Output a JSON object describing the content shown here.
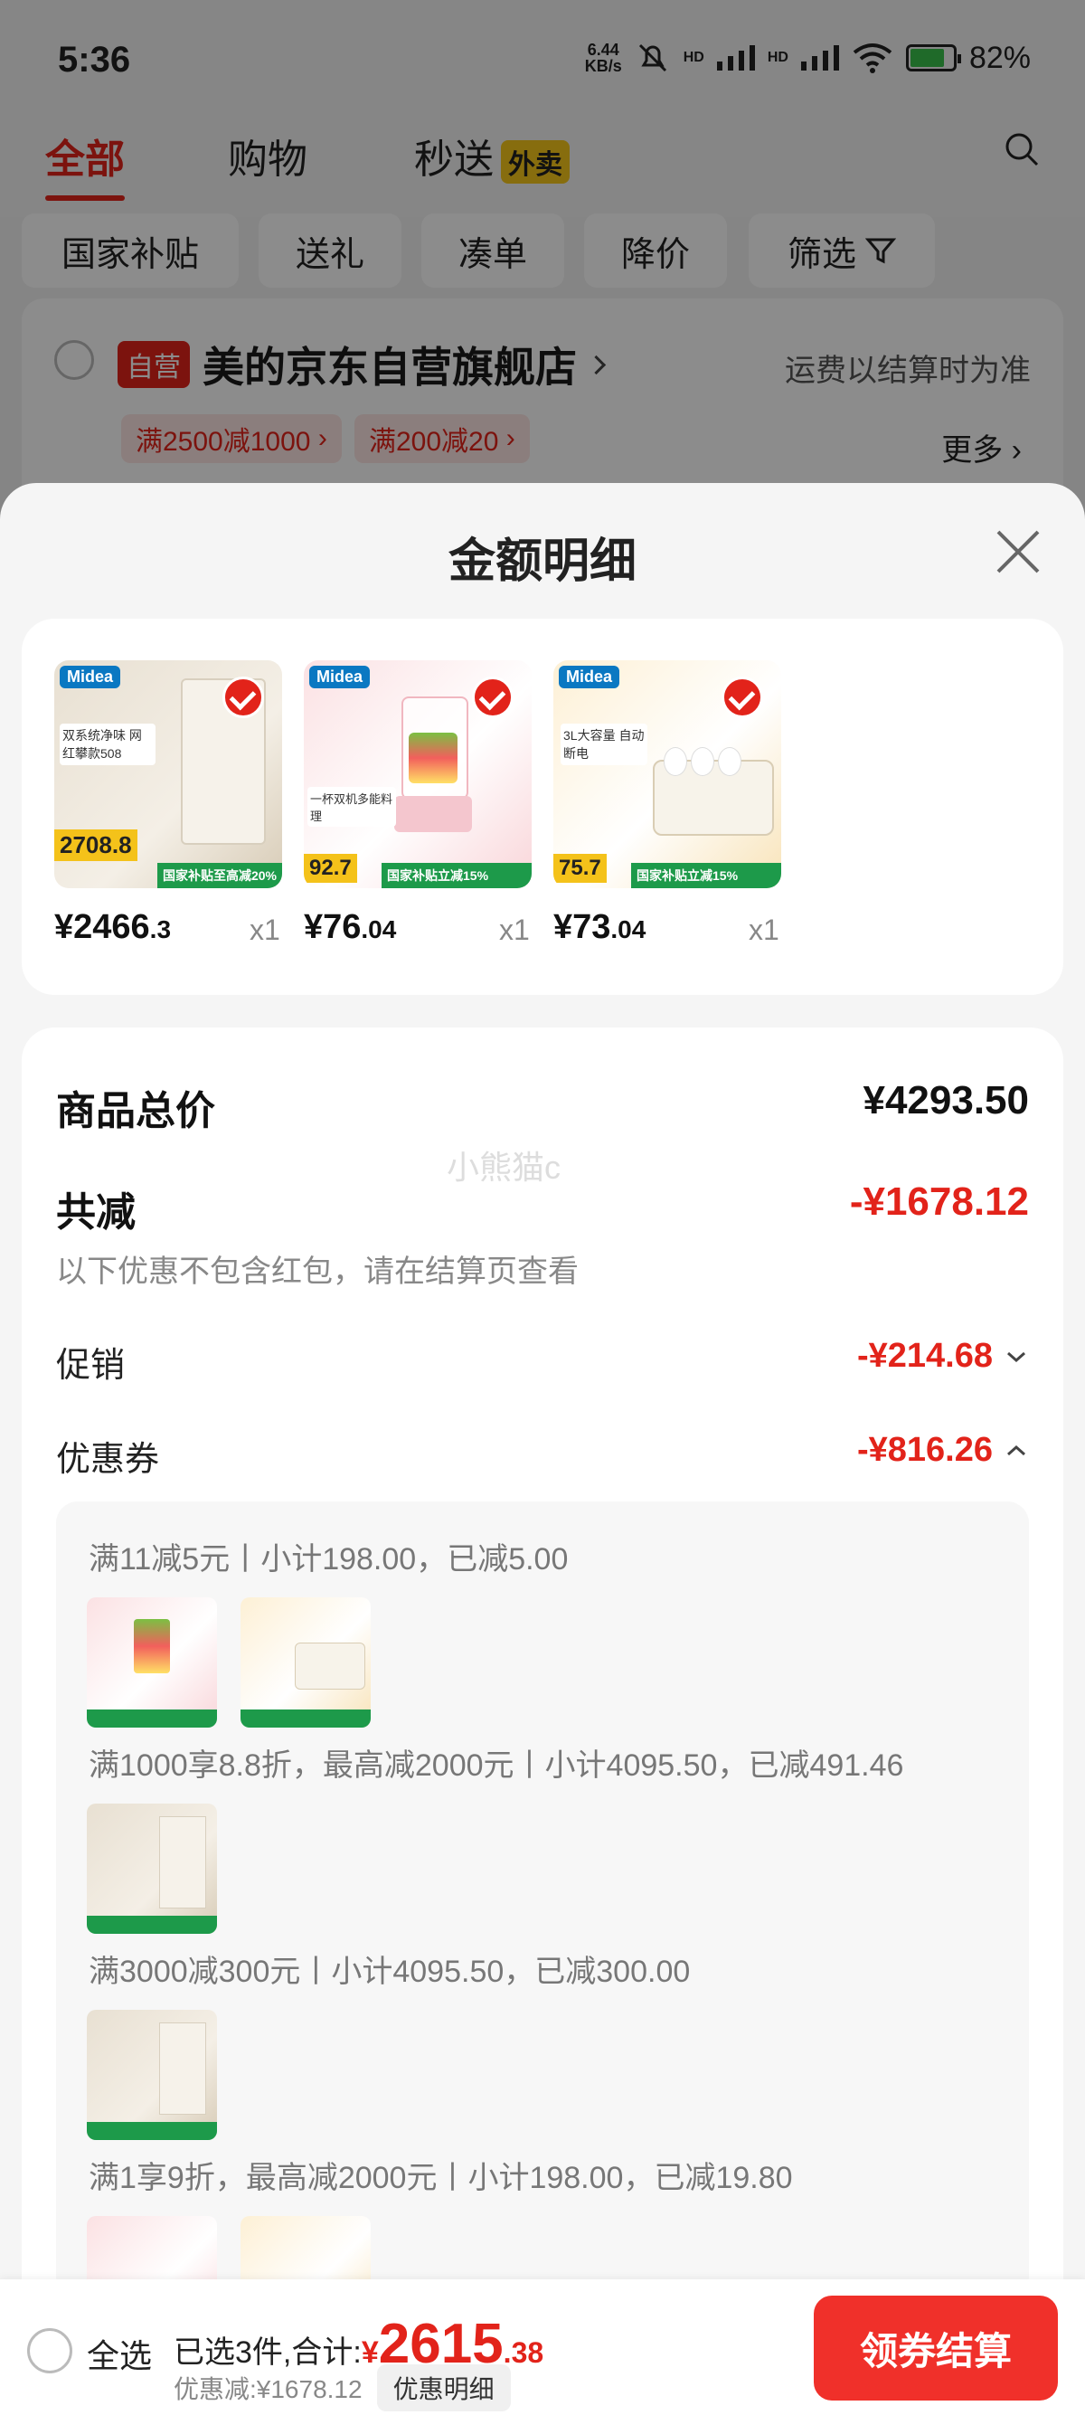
{
  "status_bar": {
    "time": "5:36",
    "net_speed_value": "6.44",
    "net_speed_unit": "KB/s",
    "battery_percent": "82%",
    "hd1": "HD",
    "hd2": "HD",
    "wifi_label": "6"
  },
  "top_tabs": [
    {
      "label": "全部",
      "active": true
    },
    {
      "label": "购物",
      "active": false
    },
    {
      "label": "秒送",
      "badge": "外卖",
      "active": false
    }
  ],
  "filters": [
    "国家补贴",
    "送礼",
    "凑单",
    "降价",
    "筛选"
  ],
  "shop": {
    "tag": "自营",
    "name": "美的京东自营旗舰店",
    "shipping_note": "运费以结算时为准",
    "coupons": [
      "满2500减1000",
      "满200减20"
    ],
    "more": "更多"
  },
  "sheet": {
    "title": "金额明细",
    "products": [
      {
        "brand": "Midea",
        "price_main": "¥2466",
        "price_decimal": ".3",
        "qty": "x1",
        "thumb_price": "2708.8",
        "thumb_promo": "国家补贴至高减20%",
        "thumb_text": "双系统净味 网红攀款508"
      },
      {
        "brand": "Midea",
        "price_main": "¥76",
        "price_decimal": ".04",
        "qty": "x1",
        "thumb_price": "92.7",
        "thumb_promo": "国家补贴立减15%",
        "thumb_text": "一杯双机多能料理"
      },
      {
        "brand": "Midea",
        "price_main": "¥73",
        "price_decimal": ".04",
        "qty": "x1",
        "thumb_price": "75.7",
        "thumb_promo": "国家补贴立减15%",
        "thumb_text": "3L大容量 自动断电"
      }
    ],
    "summary": {
      "total_label": "商品总价",
      "total_value": "¥4293.50",
      "discount_label": "共减",
      "discount_value": "-¥1678.12",
      "discount_hint": "以下优惠不包含红包，请在结算页查看",
      "promo_label": "促销",
      "promo_value": "-¥214.68",
      "coupon_label": "优惠券",
      "coupon_value": "-¥816.26"
    },
    "coupon_rules": [
      "满11减5元丨小计198.00，已减5.00",
      "满1000享8.8折，最高减2000元丨小计4095.50，已减491.46",
      "满3000减300元丨小计4095.50，已减300.00",
      "满1享9折，最高减2000元丨小计198.00，已减19.80"
    ],
    "watermark": "小熊猫c"
  },
  "bottom_bar": {
    "select_all": "全选",
    "selected_text": "已选3件,合计:",
    "currency": "¥",
    "total_main": "2615",
    "total_decimal": ".38",
    "discount_text": "优惠减:¥1678.12",
    "detail_button": "优惠明细",
    "checkout_button": "领券结算"
  },
  "colors": {
    "accent": "#e2231a",
    "checkout": "#f0302a",
    "promo_green": "#1d9a4a",
    "price_yellow": "#f4c21a"
  }
}
